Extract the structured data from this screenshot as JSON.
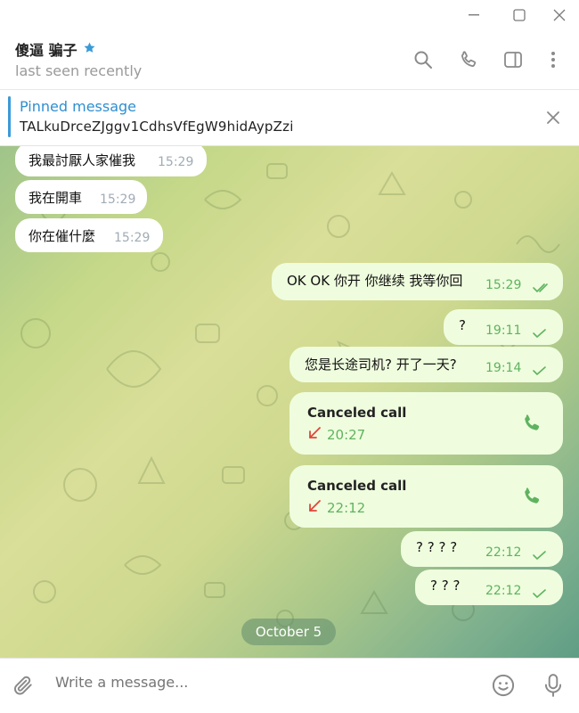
{
  "window": {
    "controls": [
      "minimize",
      "maximize",
      "close"
    ]
  },
  "header": {
    "name": "傻逼 骗子",
    "status": "last seen recently",
    "icons": [
      "star-icon",
      "search-icon",
      "phone-icon",
      "sidebar-toggle-icon",
      "more-vertical-icon"
    ]
  },
  "pinned": {
    "title": "Pinned message",
    "text": "TALkuDrceZJggv1CdhsVfEgW9hidAypZzi"
  },
  "messages": [
    {
      "dir": "in",
      "text": "我最討厭人家催我",
      "time": "15:29"
    },
    {
      "dir": "in",
      "text": "我在開車",
      "time": "15:29"
    },
    {
      "dir": "in",
      "text": "你在催什麼",
      "time": "15:29"
    },
    {
      "dir": "out",
      "text": "OK OK 你开 你继续 我等你回",
      "time": "15:29",
      "status": "read"
    },
    {
      "dir": "out",
      "text": "?",
      "time": "19:11",
      "status": "sent"
    },
    {
      "dir": "out",
      "text": "您是长途司机? 开了一天?",
      "time": "19:14",
      "status": "sent"
    },
    {
      "dir": "out",
      "type": "call",
      "text": "Canceled call",
      "time": "20:27"
    },
    {
      "dir": "out",
      "type": "call",
      "text": "Canceled call",
      "time": "22:12"
    },
    {
      "dir": "out",
      "text": "? ? ? ?",
      "time": "22:12",
      "status": "sent"
    },
    {
      "dir": "out",
      "text": "? ? ?",
      "time": "22:12",
      "status": "sent"
    }
  ],
  "date_separator": "October 5",
  "composer": {
    "placeholder": "Write a message..."
  },
  "colors": {
    "accent": "#2f8fd0",
    "outgoing_bubble": "#effdde",
    "incoming_bubble": "#ffffff",
    "outgoing_meta": "#5fb35f",
    "canceled_call": "#e0453a"
  }
}
